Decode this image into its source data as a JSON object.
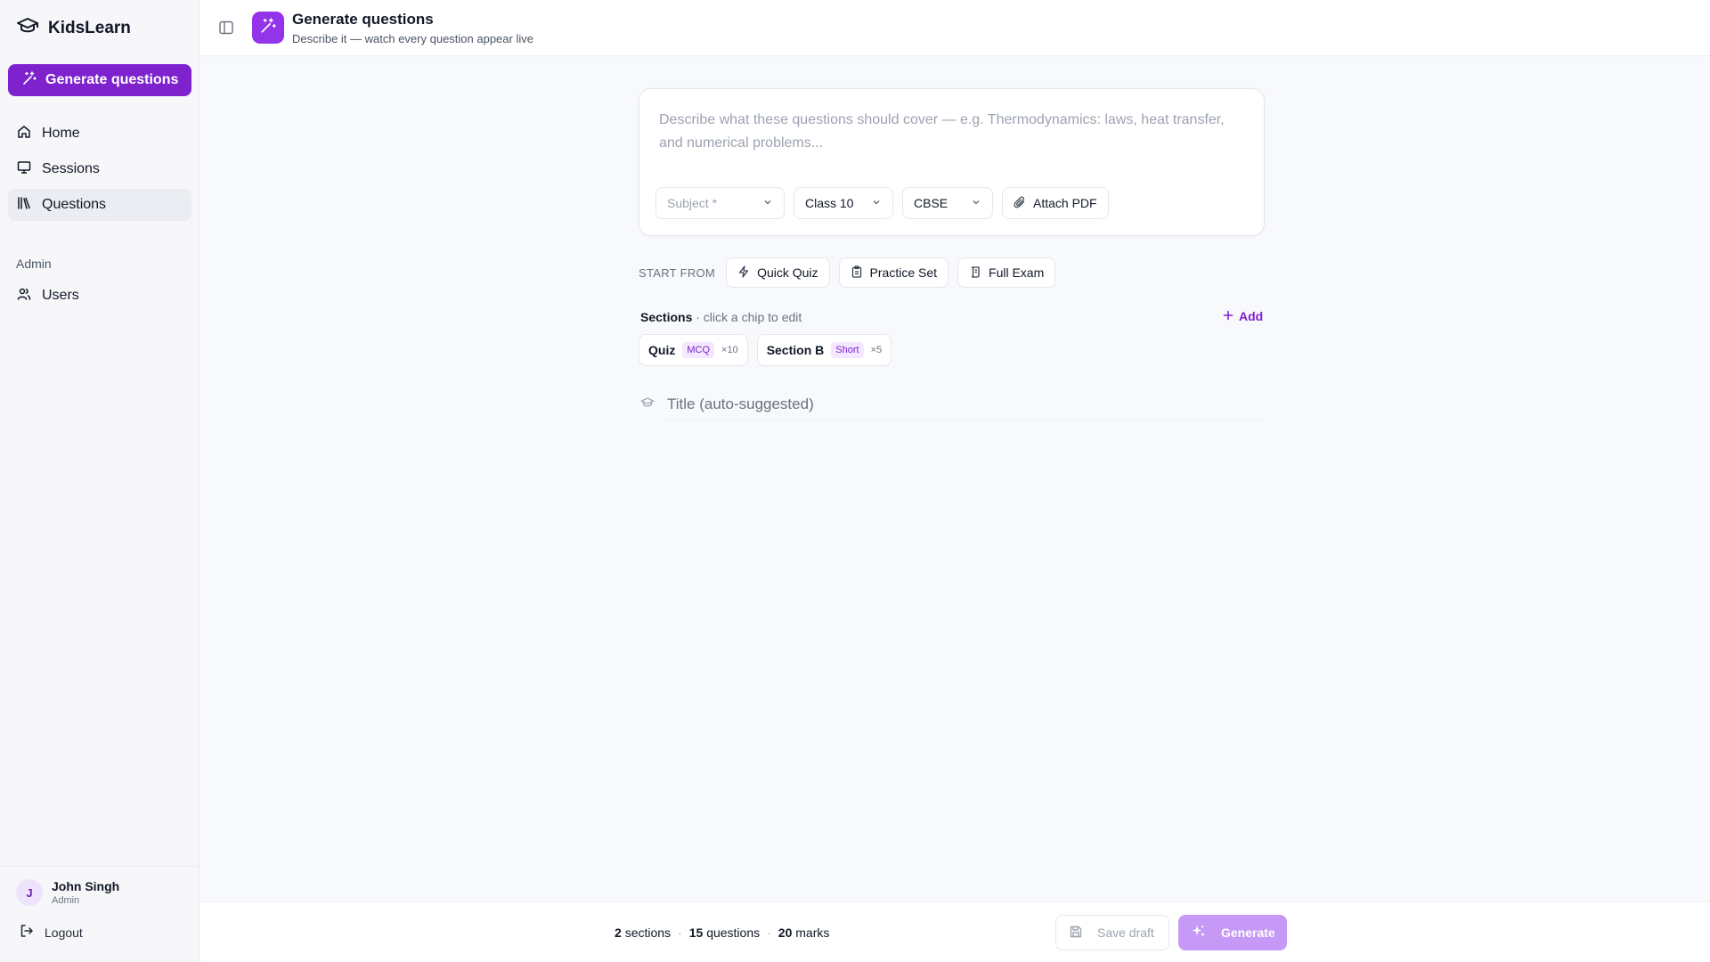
{
  "app": {
    "name": "KidsLearn"
  },
  "sidebar": {
    "generate_label": "Generate questions",
    "items": [
      {
        "label": "Home",
        "icon": "home-icon"
      },
      {
        "label": "Sessions",
        "icon": "monitor-icon"
      },
      {
        "label": "Questions",
        "icon": "library-icon",
        "active": true
      }
    ],
    "admin_heading": "Admin",
    "admin_items": [
      {
        "label": "Users",
        "icon": "users-icon"
      }
    ],
    "user": {
      "initial": "J",
      "name": "John Singh",
      "role": "Admin"
    },
    "logout_label": "Logout"
  },
  "header": {
    "title": "Generate questions",
    "subtitle": "Describe it — watch every question appear live"
  },
  "composer": {
    "placeholder": "Describe what these questions should cover — e.g. Thermodynamics: laws, heat transfer, and numerical problems...",
    "subject": "Subject *",
    "class": "Class 10",
    "board": "CBSE",
    "attach_label": "Attach PDF"
  },
  "start_from": {
    "label": "START FROM",
    "templates": [
      "Quick Quiz",
      "Practice Set",
      "Full Exam"
    ]
  },
  "sections": {
    "heading": "Sections",
    "hint": "· click a chip to edit",
    "add_label": "Add",
    "chips": [
      {
        "name": "Quiz",
        "type": "MCQ",
        "count": "×10"
      },
      {
        "name": "Section B",
        "type": "Short",
        "count": "×5"
      }
    ]
  },
  "title_field": {
    "placeholder": "Title (auto-suggested)"
  },
  "footer": {
    "sections_count": "2",
    "sections_label": "sections",
    "questions_count": "15",
    "questions_label": "questions",
    "marks_count": "20",
    "marks_label": "marks",
    "save_label": "Save draft",
    "generate_label": "Generate"
  },
  "colors": {
    "accent": "#7e22ce",
    "accent_light": "#c599f5",
    "chip_bg": "#f3e8ff"
  }
}
